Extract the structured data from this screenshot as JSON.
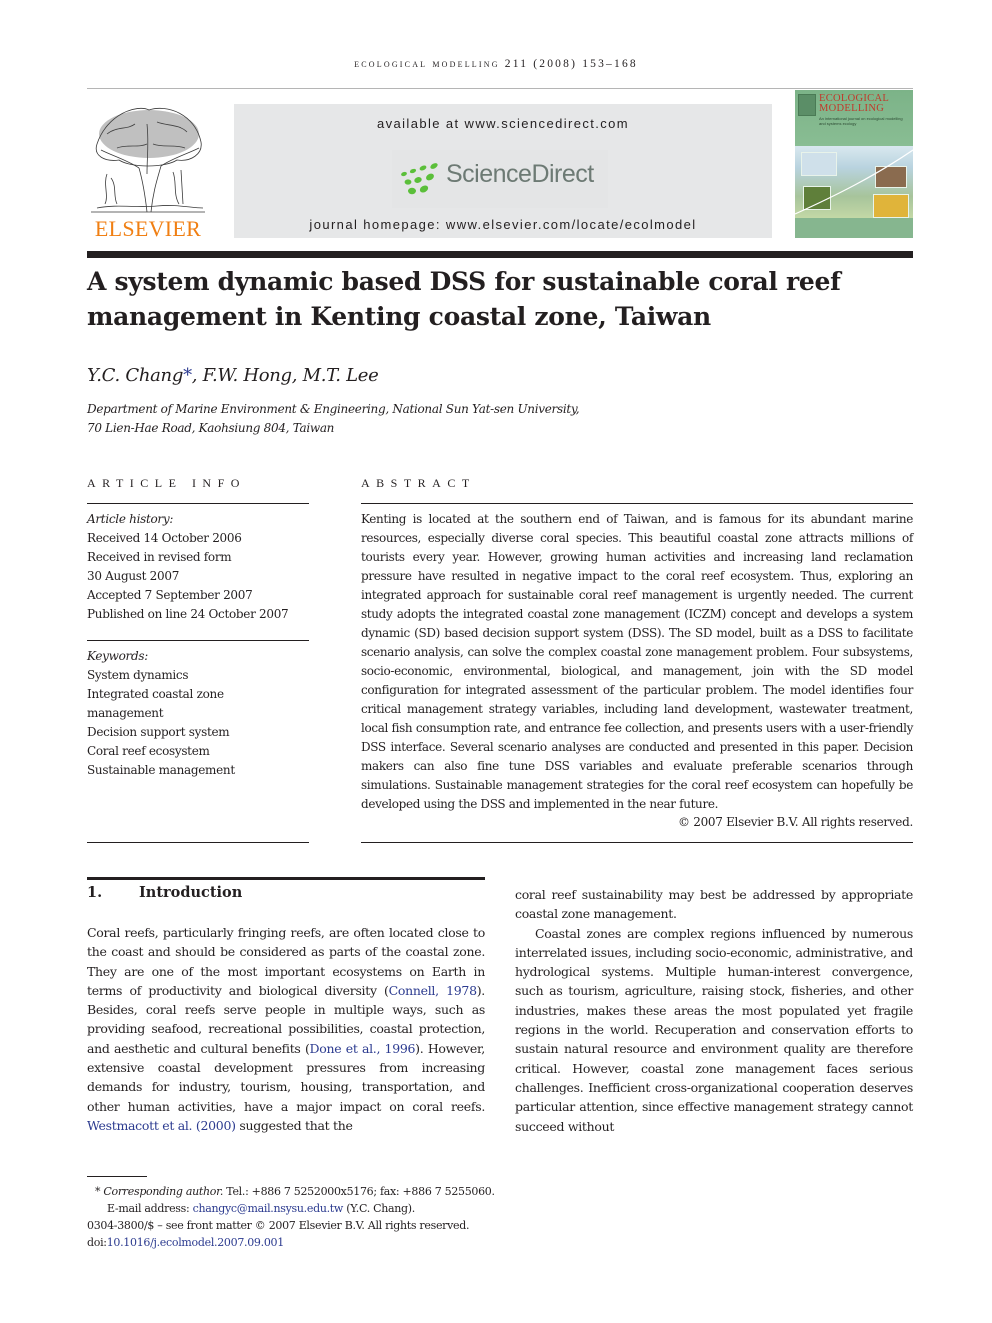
{
  "running_head": "ecological modelling 211 (2008) 153–168",
  "publisher": {
    "logo_text": "ELSEVIER",
    "brand_color": "#f07f13"
  },
  "banner": {
    "available_text": "available at www.sciencedirect.com",
    "logo_text": "ScienceDirect",
    "logo_dot_color": "#5bbf3a",
    "homepage_text": "journal homepage: www.elsevier.com/locate/ecolmodel"
  },
  "cover": {
    "title_line1": "ECOLOGICAL",
    "title_line2": "MODELLING",
    "subtitle": "An international journal on ecological modelling and systems ecology"
  },
  "article": {
    "title": "A system dynamic based DSS for sustainable coral reef management in Kenting coastal zone, Taiwan",
    "authors": {
      "first": "Y.C. Chang",
      "corresponding_mark": "*",
      "rest": ", F.W. Hong, M.T. Lee"
    },
    "affiliation_line1": "Department of Marine Environment & Engineering, National Sun Yat-sen University,",
    "affiliation_line2": "70 Lien-Hae Road, Kaohsiung 804, Taiwan"
  },
  "article_info": {
    "heading": "ARTICLE INFO",
    "history_label": "Article history:",
    "history": [
      "Received 14 October 2006",
      "Received in revised form",
      "30 August 2007",
      "Accepted 7 September 2007",
      "Published on line 24 October 2007"
    ],
    "keywords_label": "Keywords:",
    "keywords": [
      "System dynamics",
      "Integrated coastal zone",
      "management",
      "Decision support system",
      "Coral reef ecosystem",
      "Sustainable management"
    ]
  },
  "abstract": {
    "heading": "ABSTRACT",
    "text": "Kenting is located at the southern end of Taiwan, and is famous for its abundant marine resources, especially diverse coral species. This beautiful coastal zone attracts millions of tourists every year. However, growing human activities and increasing land reclamation pressure have resulted in negative impact to the coral reef ecosystem. Thus, exploring an integrated approach for sustainable coral reef management is urgently needed. The current study adopts the integrated coastal zone management (ICZM) concept and develops a system dynamic (SD) based decision support system (DSS). The SD model, built as a DSS to facilitate scenario analysis, can solve the complex coastal zone management problem. Four subsystems, socio-economic, environmental, biological, and management, join with the SD model configuration for integrated assessment of the particular problem. The model identifies four critical management strategy variables, including land development, wastewater treatment, local fish consumption rate, and entrance fee collection, and presents users with a user-friendly DSS interface. Several scenario analyses are conducted and presented in this paper. Decision makers can also fine tune DSS variables and evaluate preferable scenarios through simulations. Sustainable management strategies for the coral reef ecosystem can hopefully be developed using the DSS and implemented in the near future.",
    "copyright": "© 2007 Elsevier B.V. All rights reserved."
  },
  "introduction": {
    "number": "1.",
    "heading": "Introduction",
    "left_p1_a": "Coral reefs, particularly fringing reefs, are often located close to the coast and should be considered as parts of the coastal zone. They are one of the most important ecosystems on Earth in terms of productivity and biological diversity (",
    "cite_connell": "Connell, 1978",
    "left_p1_b": "). Besides, coral reefs serve people in multiple ways, such as providing seafood, recreational possibilities, coastal protection, and aesthetic and cultural benefits (",
    "cite_done": "Done et al., 1996",
    "left_p1_c": "). However, extensive coastal development pressures from increasing demands for industry, tourism, housing, transportation, and other human activities, have a major impact on coral reefs. ",
    "cite_westmacott": "Westmacott et al. (2000)",
    "left_p1_d": " suggested that the",
    "right_p1": "coral reef sustainability may best be addressed by appropriate coastal zone management.",
    "right_p2": "Coastal zones are complex regions influenced by numerous interrelated issues, including socio-economic, administrative, and hydrological systems. Multiple human-interest convergence, such as tourism, agriculture, raising stock, fisheries, and other industries, makes these areas the most populated yet fragile regions in the world. Recuperation and conservation efforts to sustain natural resource and environment quality are therefore critical. However, coastal zone management faces serious challenges. Inefficient cross-organizational cooperation deserves particular attention, since effective management strategy cannot succeed without"
  },
  "footnotes": {
    "mark": "*",
    "corresponding_label": "Corresponding author.",
    "contact": " Tel.: +886 7 5252000x5176; fax: +886 7 5255060.",
    "email_label": "E-mail address: ",
    "email": "changyc@mail.nsysu.edu.tw",
    "email_suffix": " (Y.C. Chang).",
    "front_matter": "0304-3800/$ – see front matter © 2007 Elsevier B.V. All rights reserved.",
    "doi_label": "doi:",
    "doi": "10.1016/j.ecolmodel.2007.09.001"
  }
}
